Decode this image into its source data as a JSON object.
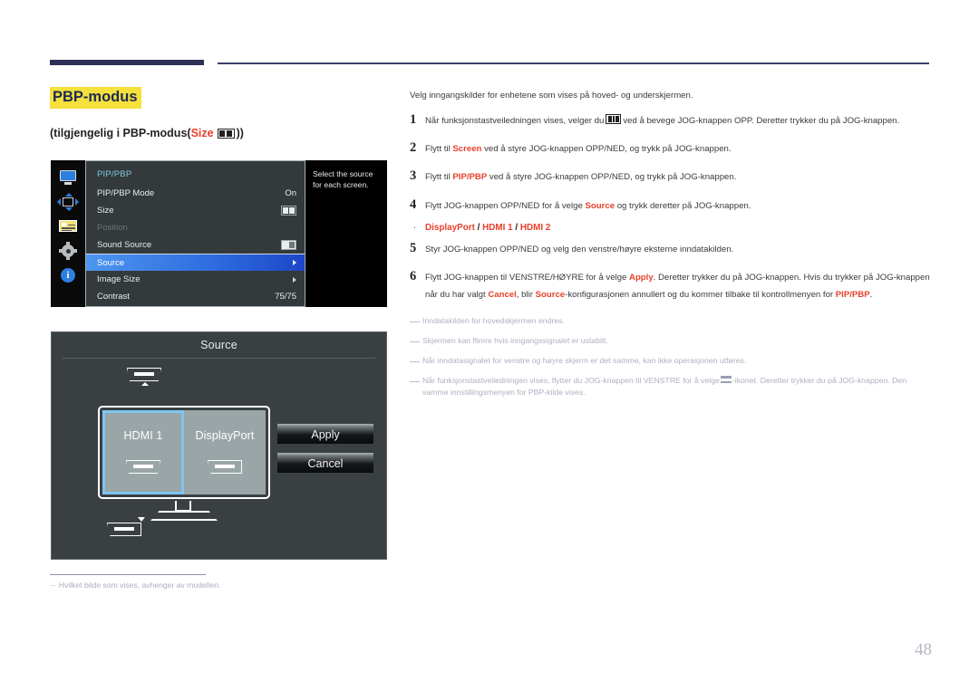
{
  "header": {
    "title": "PBP-modus",
    "subtitle_pre": "(tilgjengelig i PBP-modus(",
    "subtitle_red": "Size",
    "subtitle_post": "))"
  },
  "osd": {
    "menu_title": "PIP/PBP",
    "tooltip": "Select the source for each screen.",
    "sidebar_icons": [
      "monitor-icon",
      "pip-position-arrows-icon",
      "onscreen-display-icon",
      "system-gear-icon",
      "information-icon"
    ],
    "info_glyph": "i",
    "rows": [
      {
        "label": "PIP/PBP Mode",
        "value": "On",
        "type": "text"
      },
      {
        "label": "Size",
        "value": "",
        "type": "size-icon"
      },
      {
        "label": "Position",
        "value": "",
        "type": "disabled"
      },
      {
        "label": "Sound Source",
        "value": "",
        "type": "sound-icon"
      },
      {
        "label": "Source",
        "value": "",
        "type": "selected-arrow"
      },
      {
        "label": "Image Size",
        "value": "",
        "type": "arrow"
      },
      {
        "label": "Contrast",
        "value": "75/75",
        "type": "text"
      }
    ]
  },
  "source_dialog": {
    "title": "Source",
    "left_panel": {
      "label": "HDMI 1",
      "connector": "hdmi-connector-icon",
      "selected": true
    },
    "right_panel": {
      "label": "DisplayPort",
      "connector": "displayport-connector-icon",
      "selected": false
    },
    "apply_label": "Apply",
    "cancel_label": "Cancel"
  },
  "left_footnote": {
    "dash": "–",
    "text": "Hvilket bilde som vises, avhenger av modellen."
  },
  "instructions": {
    "intro": "Velg inngangskilder for enhetene som vises på hoved- og underskjermen.",
    "steps": [
      {
        "num": "1",
        "pre": "Når funksjonstastveiledningen vises, velger du",
        "icon": "pbp-jog-glyph-icon",
        "post": "ved å bevege JOG-knappen OPP. Deretter trykker du på JOG-knappen."
      },
      {
        "num": "2",
        "pre": "Flytt til",
        "bold": "Screen",
        "post": "ved å styre JOG-knappen OPP/NED, og trykk på JOG-knappen."
      },
      {
        "num": "3",
        "pre": "Flytt til",
        "bold": "PIP/PBP",
        "post": "ved å styre JOG-knappen OPP/NED, og trykk på JOG-knappen."
      },
      {
        "num": "4",
        "pre": "Flytt JOG-knappen OPP/NED for å velge",
        "bold": "Source",
        "post": "og trykk deretter på JOG-knappen."
      },
      {
        "num": "5",
        "pre": "Styr JOG-knappen OPP/NED og velg den venstre/høyre eksterne inndatakilden.",
        "bold": "",
        "post": ""
      }
    ],
    "bullet": {
      "marker": "·",
      "opt1": "DisplayPort",
      "sep1": " / ",
      "opt2": "HDMI 1",
      "sep2": " / ",
      "opt3": "HDMI 2"
    },
    "step6": {
      "num": "6",
      "p1": "Flytt JOG-knappen til VENSTRE/HØYRE for å velge",
      "b1": "Apply",
      "p2": ". Deretter trykker du på JOG-knappen. Hvis du trykker på JOG-knappen når du har valgt",
      "b2": "Cancel",
      "p3": ", blir",
      "b3": "Source",
      "p4": "-konfigurasjonen annullert og du kommer tilbake til kontrollmenyen for",
      "b4": "PIP/PBP",
      "p5": "."
    },
    "notes": [
      {
        "text": "Inndatakilden for hovedskjermen endres."
      },
      {
        "text": "Skjermen kan flimre hvis inngangssignalet er ustabilt."
      },
      {
        "text": "Når inndatasignalet for venstre og høyre skjerm er det samme, kan ikke operasjonen utføres."
      }
    ],
    "note_last": {
      "pre": "Når funksjonstastveiledningen vises, flytter du JOG-knappen til VENSTRE for å velge",
      "icon": "pbp-swap-icon",
      "post": "-ikonet. Deretter trykker du på JOG-knappen. Den samme innstillingsmenyen for PBP-kilde vises."
    }
  },
  "page_number": "48",
  "colors": {
    "accent_red": "#e8402a",
    "highlight_yellow": "#f5e03c",
    "navy": "#2e3158",
    "osd_blue": "#2f7fe0",
    "selection_blue": "#7ec6f0"
  }
}
